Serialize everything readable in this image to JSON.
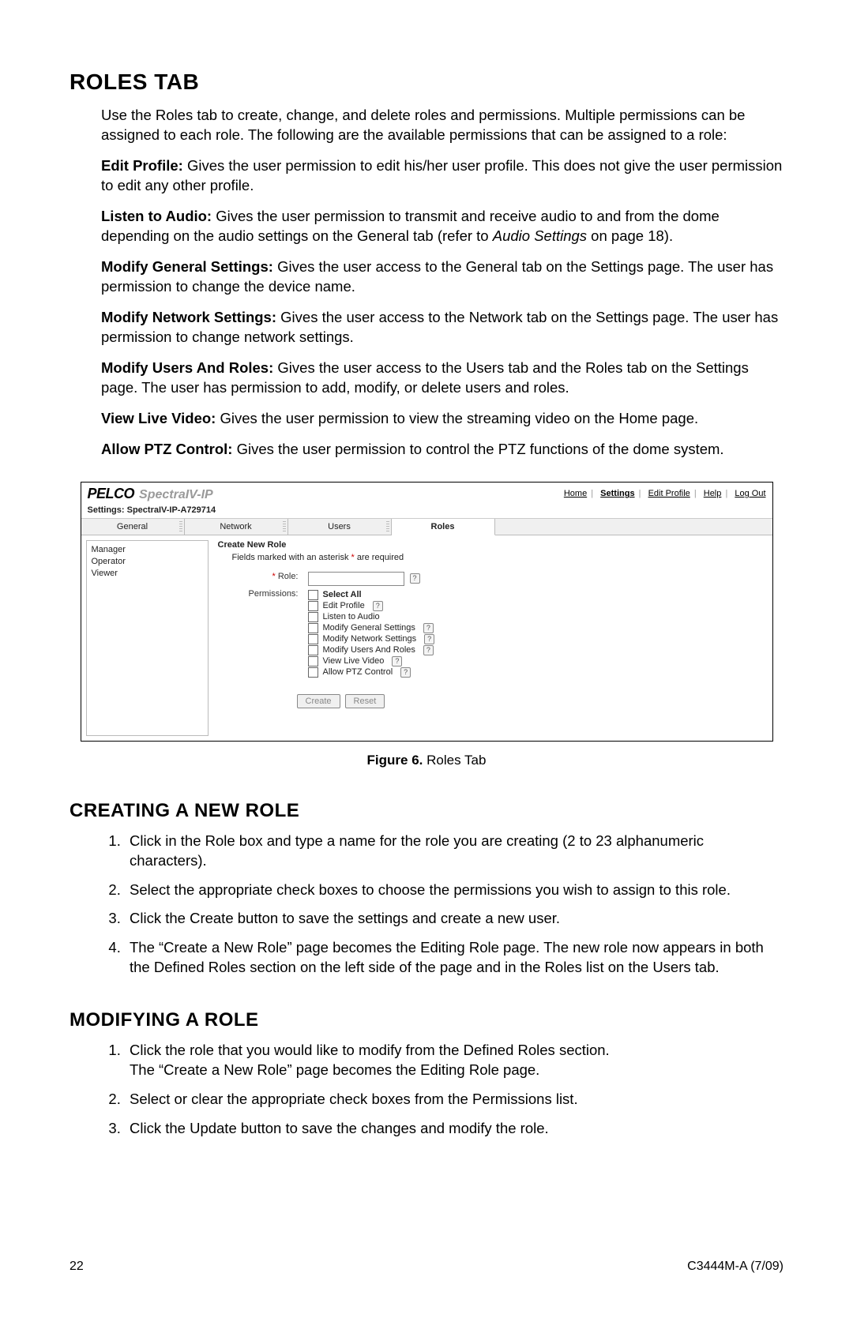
{
  "heading": "ROLES TAB",
  "intro": "Use the Roles tab to create, change, and delete roles and permissions. Multiple permissions can be assigned to each role. The following are the available permissions that can be assigned to a role:",
  "perm_defs": [
    {
      "term": "Edit Profile:",
      "desc": "Gives the user permission to edit his/her user profile. This does not give the user permission to edit any other profile."
    },
    {
      "term": "Listen to Audio:",
      "desc_pre": "Gives the user permission to transmit and receive audio to and from the dome depending on the audio settings on the General tab (refer to ",
      "desc_ital": "Audio Settings",
      "desc_post": " on page 18)."
    },
    {
      "term": "Modify General Settings:",
      "desc": "Gives the user access to the General tab on the Settings page. The user has permission to change the device name."
    },
    {
      "term": "Modify Network Settings:",
      "desc": "Gives the user access to the Network tab on the Settings page. The user has permission to change network settings."
    },
    {
      "term": "Modify Users And Roles:",
      "desc": "Gives the user access to the Users tab and the Roles tab on the Settings page. The user has permission to add, modify, or delete users and roles."
    },
    {
      "term": "View Live Video:",
      "desc": "Gives the user permission to view the streaming video on the Home page."
    },
    {
      "term": "Allow PTZ Control:",
      "desc": "Gives the user permission to control the PTZ functions of the dome system."
    }
  ],
  "figure": {
    "brand_logo": "PELCO",
    "brand_product": "SpectraIV-IP",
    "top_links": [
      "Home",
      "Settings",
      "Edit Profile",
      "Help",
      "Log Out"
    ],
    "top_link_current": "Settings",
    "breadcrumb": "Settings: SpectraIV-IP-A729714",
    "tabs": [
      "General",
      "Network",
      "Users",
      "Roles"
    ],
    "active_tab": "Roles",
    "sidebar_roles": [
      "Manager",
      "Operator",
      "Viewer"
    ],
    "form_title": "Create New Role",
    "form_note_pre": "Fields marked with an asterisk ",
    "form_note_ast": "*",
    "form_note_post": " are required",
    "label_role": "Role:",
    "label_permissions": "Permissions:",
    "perm_select_all": "Select All",
    "permissions": [
      {
        "label": "Edit Profile",
        "help": true
      },
      {
        "label": "Listen to Audio",
        "help": false
      },
      {
        "label": "Modify General Settings",
        "help": true
      },
      {
        "label": "Modify Network Settings",
        "help": true
      },
      {
        "label": "Modify Users And Roles",
        "help": true
      },
      {
        "label": "View Live Video",
        "help": true
      },
      {
        "label": "Allow PTZ Control",
        "help": true
      }
    ],
    "btn_create": "Create",
    "btn_reset": "Reset",
    "caption_bold": "Figure 6.",
    "caption_text": "Roles Tab"
  },
  "sec_create_heading": "CREATING A NEW ROLE",
  "create_steps": [
    "Click in the Role box and type a name for the role you are creating (2 to 23 alphanumeric characters).",
    "Select the appropriate check boxes to choose the permissions you wish to assign to this role.",
    "Click the Create button to save the settings and create a new user.",
    "The “Create a New Role” page becomes the Editing Role page. The new role now appears in both the Defined Roles section on the left side of the page and in the Roles list on the Users tab."
  ],
  "sec_modify_heading": "MODIFYING A ROLE",
  "modify_steps": [
    "Click the role that you would like to modify from the Defined Roles section.",
    "The “Create a New Role” page becomes the Editing Role page.",
    "Select or clear the appropriate check boxes from the Permissions list.",
    "Click the Update button to save the changes and modify the role."
  ],
  "footer_left": "22",
  "footer_right": "C3444M-A (7/09)"
}
